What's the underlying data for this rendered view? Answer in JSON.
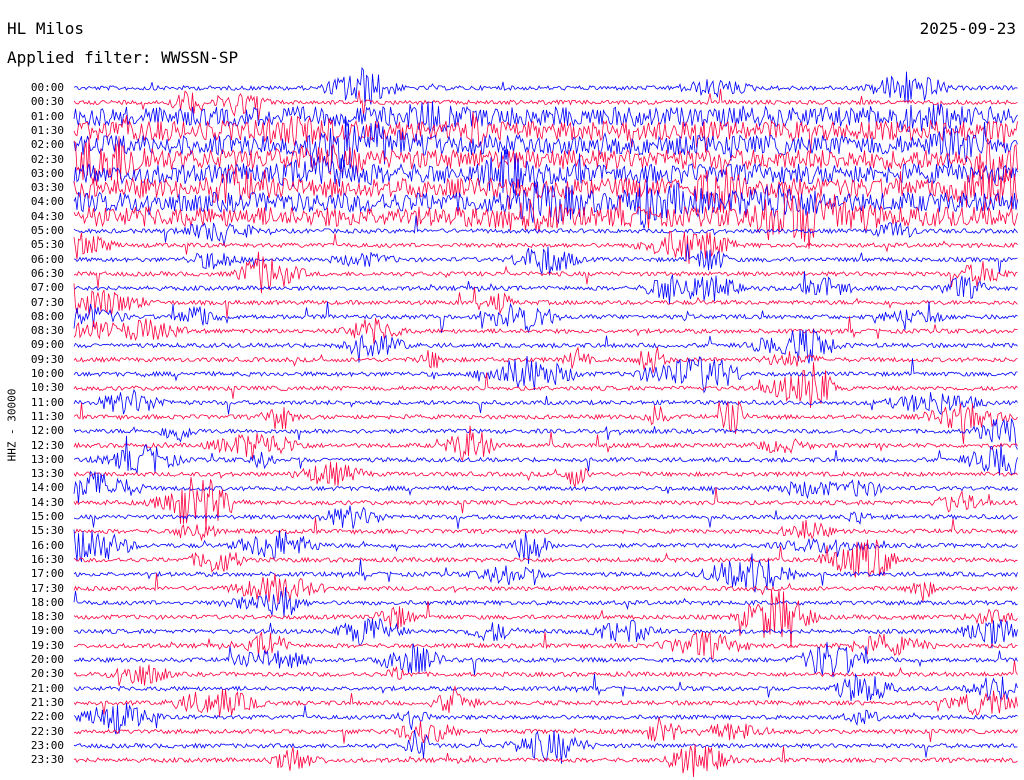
{
  "header": {
    "station": "HL Milos",
    "date": "2025-09-23",
    "filter_label": "Applied filter: WWSSN-SP"
  },
  "chart_data": {
    "type": "line",
    "title": "HL Milos",
    "subtitle": "Applied filter: WWSSN-SP",
    "ylabel": "HHZ - 30000",
    "xlabel": "",
    "row_labels": [
      "00:00",
      "00:30",
      "01:00",
      "01:30",
      "02:00",
      "02:30",
      "03:00",
      "03:30",
      "04:00",
      "04:30",
      "05:00",
      "05:30",
      "06:00",
      "06:30",
      "07:00",
      "07:30",
      "08:00",
      "08:30",
      "09:00",
      "09:30",
      "10:00",
      "10:30",
      "11:00",
      "11:30",
      "12:00",
      "12:30",
      "13:00",
      "13:30",
      "14:00",
      "14:30",
      "15:00",
      "15:30",
      "16:00",
      "16:30",
      "17:00",
      "17:30",
      "18:00",
      "18:30",
      "19:00",
      "19:30",
      "20:00",
      "20:30",
      "21:00",
      "21:30",
      "22:00",
      "22:30",
      "23:00",
      "23:30"
    ],
    "trace_colors": [
      "#0000ff",
      "#ff0040"
    ],
    "grid": false
  }
}
